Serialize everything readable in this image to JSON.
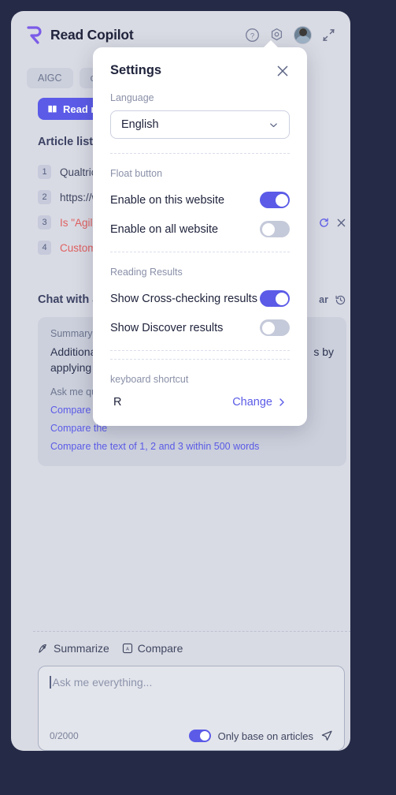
{
  "header": {
    "brand": "Read Copilot",
    "icons": {
      "help": "help-circle-icon",
      "settings": "settings-gear-icon",
      "avatar": "user-avatar",
      "collapse": "collapse-arrows-icon"
    }
  },
  "tabs": [
    {
      "label": "AIGC"
    },
    {
      "label": "c"
    }
  ],
  "read_now": {
    "label": "Read now",
    "icon": "book-icon"
  },
  "article_list": {
    "title": "Article list (4",
    "rows": [
      {
        "index": "1",
        "text": "Qualtrics",
        "error": false
      },
      {
        "index": "2",
        "text": "https://w",
        "error": false
      },
      {
        "index": "3",
        "text": "Is \"Agile\"",
        "error": true
      },
      {
        "index": "4",
        "text": "Custome",
        "error": true
      }
    ]
  },
  "chat": {
    "title": "Chat with art",
    "clear_label": "ar",
    "history_icon": "history-clock-icon",
    "summary_label": "Summary of ",
    "summary_body_line1": "Additionally",
    "summary_body_line1_tail": "s by",
    "summary_body_line2": "applying de",
    "ask_label": "Ask me quest",
    "suggestions": [
      "Compare the",
      "Compare the",
      "Compare the text of 1, 2 and 3 within 500 words"
    ]
  },
  "quick_actions": [
    {
      "label": "Summarize",
      "icon": "pen-summarize-icon"
    },
    {
      "label": "Compare",
      "icon": "compare-icon"
    }
  ],
  "composer": {
    "placeholder": "Ask me everything...",
    "counter": "0/2000",
    "only_base_label": "Only base on articles",
    "only_base_on": true,
    "send_icon": "send-paper-plane-icon"
  },
  "settings": {
    "title": "Settings",
    "close_icon": "close-icon",
    "language_label": "Language",
    "language_value": "English",
    "float_button_label": "Float button",
    "float_rows": [
      {
        "label": "Enable on this website",
        "on": true
      },
      {
        "label": "Enable on all website",
        "on": false
      }
    ],
    "reading_results_label": "Reading Results",
    "reading_rows": [
      {
        "label": "Show Cross-checking results",
        "on": true
      },
      {
        "label": "Show Discover results",
        "on": false
      }
    ],
    "shortcut_label": "keyboard shortcut",
    "shortcut_key": "R",
    "change_label": "Change"
  },
  "colors": {
    "accent": "#5b5be8",
    "panel_bg": "#d9dbe4",
    "page_bg": "#252a47",
    "error": "#e06060"
  }
}
